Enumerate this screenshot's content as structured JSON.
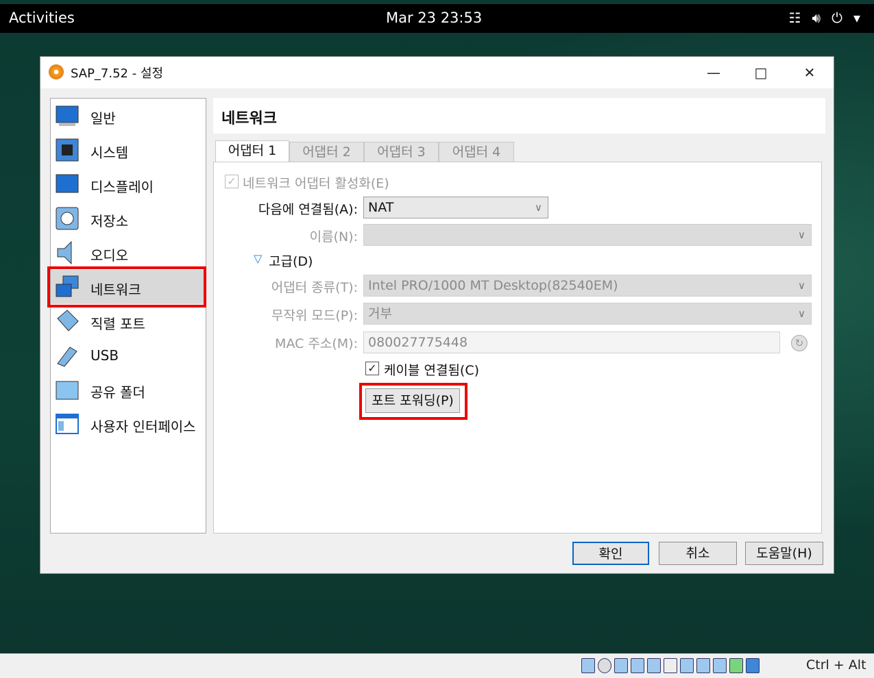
{
  "topbar": {
    "activities": "Activities",
    "clock": "Mar 23  23:53",
    "tray_icons": [
      "network-icon",
      "volume-icon",
      "power-icon",
      "chevron-down-icon"
    ]
  },
  "window": {
    "title": "SAP_7.52 - 설정",
    "app_icon": "virtualbox-settings-icon"
  },
  "sidebar": {
    "items": [
      {
        "label": "일반",
        "icon": "general-icon"
      },
      {
        "label": "시스템",
        "icon": "system-icon"
      },
      {
        "label": "디스플레이",
        "icon": "display-icon"
      },
      {
        "label": "저장소",
        "icon": "storage-icon"
      },
      {
        "label": "오디오",
        "icon": "audio-icon"
      },
      {
        "label": "네트워크",
        "icon": "network-icon",
        "selected": true
      },
      {
        "label": "직렬 포트",
        "icon": "serial-port-icon"
      },
      {
        "label": "USB",
        "icon": "usb-icon"
      },
      {
        "label": "공유 폴더",
        "icon": "shared-folder-icon"
      },
      {
        "label": "사용자 인터페이스",
        "icon": "user-interface-icon"
      }
    ]
  },
  "main": {
    "section_title": "네트워크",
    "tabs": [
      {
        "label": "어댑터 1",
        "active": true
      },
      {
        "label": "어댑터 2"
      },
      {
        "label": "어댑터 3"
      },
      {
        "label": "어댑터 4"
      }
    ],
    "enable_adapter": {
      "label": "네트워크 어댑터 활성화(E)",
      "checked": true
    },
    "attached_to": {
      "label": "다음에 연결됨(A):",
      "value": "NAT"
    },
    "name": {
      "label": "이름(N):",
      "value": ""
    },
    "advanced": {
      "label": "고급(D)"
    },
    "adapter_type": {
      "label": "어댑터 종류(T):",
      "value": "Intel PRO/1000 MT Desktop(82540EM)"
    },
    "promiscuous": {
      "label": "무작위 모드(P):",
      "value": "거부"
    },
    "mac": {
      "label": "MAC 주소(M):",
      "value": "080027775448"
    },
    "cable_connected": {
      "label": "케이블 연결됨(C)",
      "checked": true
    },
    "port_forwarding": {
      "label": "포트 포워딩(P)"
    }
  },
  "footer": {
    "ok": "확인",
    "cancel": "취소",
    "help": "도움말(H)"
  },
  "statusbar": {
    "host_key": "Ctrl + Alt"
  },
  "colors": {
    "highlight": "#e00000",
    "accent": "#0a64c8"
  }
}
